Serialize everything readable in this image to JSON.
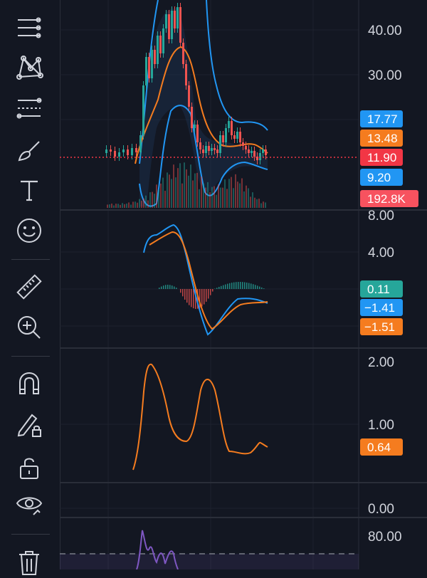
{
  "toolbar": {
    "tools": [
      {
        "name": "trend-lines-icon"
      },
      {
        "name": "patterns-icon"
      },
      {
        "name": "fib-tools-icon"
      },
      {
        "name": "brush-icon"
      },
      {
        "name": "text-icon"
      },
      {
        "name": "emoji-icon"
      },
      {
        "name": "ruler-icon"
      },
      {
        "name": "zoom-in-icon"
      },
      {
        "name": "magnet-icon"
      },
      {
        "name": "lock-drawing-icon"
      },
      {
        "name": "unlock-icon"
      },
      {
        "name": "eye-icon"
      },
      {
        "name": "trash-icon"
      }
    ]
  },
  "price_pane": {
    "axis_ticks": [
      "40.00",
      "30.00"
    ],
    "badges": [
      {
        "label": "17.77",
        "color": "#2196f3"
      },
      {
        "label": "13.48",
        "color": "#f57c1f"
      },
      {
        "label": "11.90",
        "color": "#f23645"
      },
      {
        "label": "9.20",
        "color": "#2196f3"
      },
      {
        "label": "192.8K",
        "color": "#f7525f"
      }
    ]
  },
  "macd_pane": {
    "axis_ticks": [
      "8.00",
      "4.00"
    ],
    "badges": [
      {
        "label": "0.11",
        "color": "#26a69a"
      },
      {
        "label": "−1.41",
        "color": "#2196f3"
      },
      {
        "label": "−1.51",
        "color": "#f57c1f"
      }
    ]
  },
  "atr_pane": {
    "axis_ticks": [
      "2.00",
      "1.00",
      "0.00"
    ],
    "badges": [
      {
        "label": "0.64",
        "color": "#f57c1f"
      }
    ]
  },
  "rsi_pane": {
    "axis_ticks": [
      "80.00"
    ]
  },
  "colors": {
    "background": "#131722",
    "grid": "#1f2430",
    "up": "#26a69a",
    "down": "#ef5350",
    "blue": "#2196f3",
    "orange": "#f57c1f",
    "purple": "#7e57c2"
  }
}
